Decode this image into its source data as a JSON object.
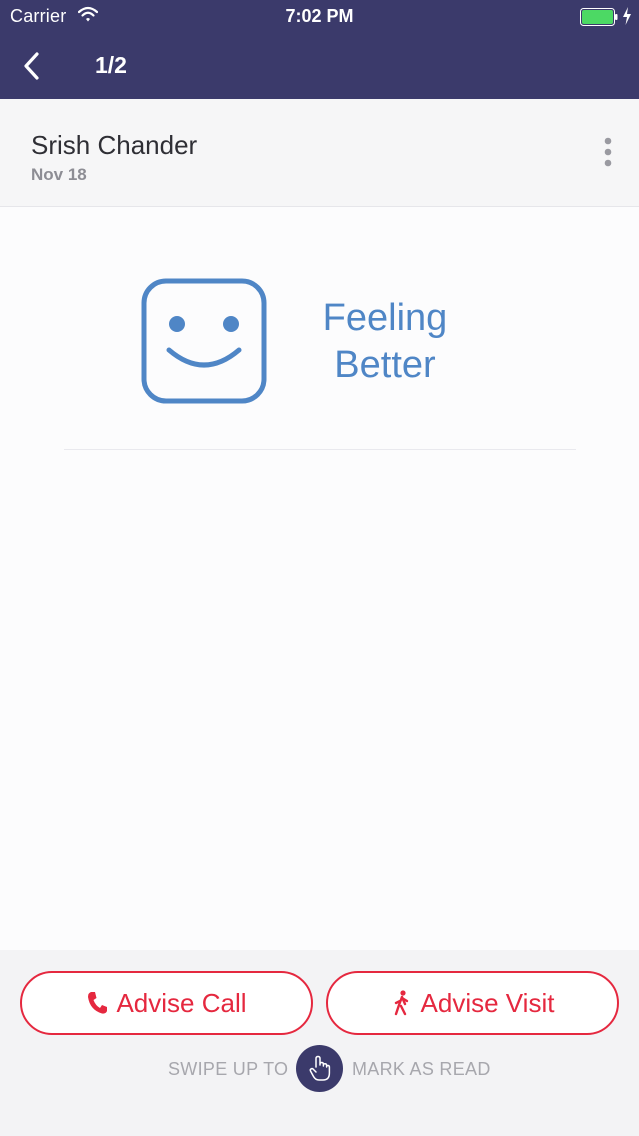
{
  "status_bar": {
    "carrier": "Carrier",
    "time": "7:02 PM",
    "icons": [
      "wifi-icon",
      "battery-icon",
      "charging-icon"
    ]
  },
  "nav": {
    "title": "1/2",
    "back_icon": "chevron-left-icon"
  },
  "patient": {
    "name": "Srish Chander",
    "date": "Nov 18",
    "menu_icon": "more-vertical-icon"
  },
  "mood": {
    "icon": "smiley-face-icon",
    "label": "Feeling Better"
  },
  "actions": {
    "advise_call": "Advise Call",
    "advise_visit": "Advise Visit"
  },
  "swipe": {
    "left_text": "SWIPE UP TO",
    "right_text": "MARK AS READ",
    "icon": "hand-pointer-icon"
  },
  "colors": {
    "header_bg": "#3b3a6b",
    "accent_red": "#e5283f",
    "mood_blue": "#4f86c6"
  }
}
